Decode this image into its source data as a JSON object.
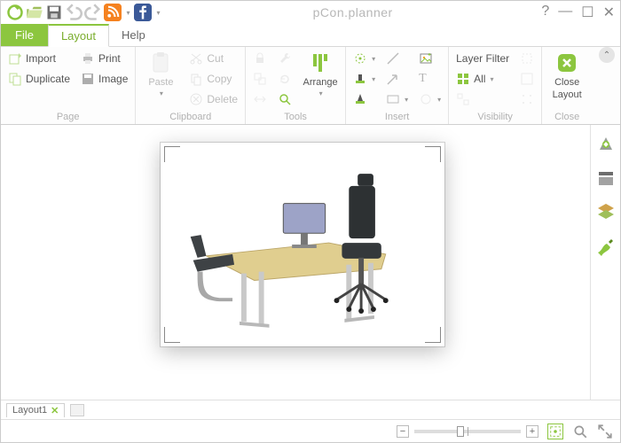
{
  "title": "pCon.planner",
  "tabs": {
    "file": "File",
    "layout": "Layout",
    "help": "Help"
  },
  "ribbon": {
    "page": {
      "label": "Page",
      "import": "Import",
      "duplicate": "Duplicate",
      "print": "Print",
      "image": "Image"
    },
    "clipboard": {
      "label": "Clipboard",
      "paste": "Paste",
      "cut": "Cut",
      "copy": "Copy",
      "delete": "Delete"
    },
    "tools": {
      "label": "Tools",
      "arrange": "Arrange"
    },
    "insert": {
      "label": "Insert"
    },
    "visibility": {
      "label": "Visibility",
      "layer_filter": "Layer Filter",
      "all": "All"
    },
    "close": {
      "label": "Close",
      "btn1": "Close",
      "btn2": "Layout"
    }
  },
  "doc_tabs": {
    "name": "Layout1"
  },
  "accent": "#8cc63f"
}
